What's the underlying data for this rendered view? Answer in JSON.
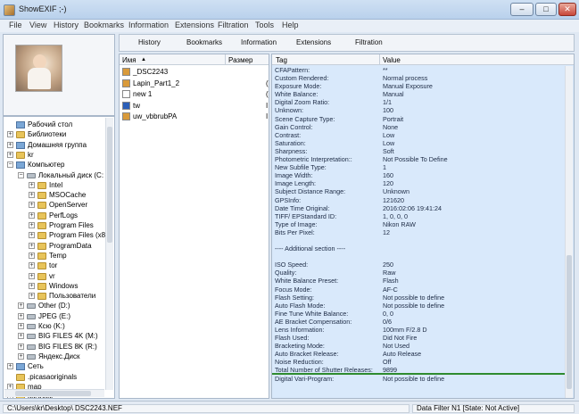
{
  "window": {
    "title": "ShowEXIF ;-)",
    "minimize": "–",
    "maximize": "□",
    "close": "✕"
  },
  "menu": [
    "File",
    "View",
    "History",
    "Bookmarks",
    "Information",
    "Extensions",
    "Filtration",
    "Tools",
    "Help"
  ],
  "tabs": [
    "History",
    "Bookmarks",
    "Information",
    "Extensions",
    "Filtration"
  ],
  "tree": [
    {
      "label": "Рабочий стол",
      "level": 0,
      "expander": "",
      "icon": "desktop"
    },
    {
      "label": "Библиотеки",
      "level": 0,
      "expander": "+",
      "icon": "folder"
    },
    {
      "label": "Домашняя группа",
      "level": 0,
      "expander": "+",
      "icon": "homegroup"
    },
    {
      "label": "kr",
      "level": 0,
      "expander": "+",
      "icon": "folder"
    },
    {
      "label": "Компьютер",
      "level": 0,
      "expander": "−",
      "icon": "computer"
    },
    {
      "label": "Локальный диск (C:",
      "level": 1,
      "expander": "−",
      "icon": "drive"
    },
    {
      "label": "Intel",
      "level": 2,
      "expander": "+",
      "icon": "folder"
    },
    {
      "label": "MSOCache",
      "level": 2,
      "expander": "+",
      "icon": "folder"
    },
    {
      "label": "OpenServer",
      "level": 2,
      "expander": "+",
      "icon": "folder"
    },
    {
      "label": "PerfLogs",
      "level": 2,
      "expander": "+",
      "icon": "folder"
    },
    {
      "label": "Program Files",
      "level": 2,
      "expander": "+",
      "icon": "folder"
    },
    {
      "label": "Program Files (x8",
      "level": 2,
      "expander": "+",
      "icon": "folder"
    },
    {
      "label": "ProgramData",
      "level": 2,
      "expander": "+",
      "icon": "folder"
    },
    {
      "label": "Temp",
      "level": 2,
      "expander": "+",
      "icon": "folder"
    },
    {
      "label": "tor",
      "level": 2,
      "expander": "+",
      "icon": "folder"
    },
    {
      "label": "vr",
      "level": 2,
      "expander": "+",
      "icon": "folder"
    },
    {
      "label": "Windows",
      "level": 2,
      "expander": "+",
      "icon": "folder"
    },
    {
      "label": "Пользователи",
      "level": 2,
      "expander": "+",
      "icon": "folder"
    },
    {
      "label": "Other (D:)",
      "level": 1,
      "expander": "+",
      "icon": "drive"
    },
    {
      "label": "JPEG (E:)",
      "level": 1,
      "expander": "+",
      "icon": "drive"
    },
    {
      "label": "Ксю (K:)",
      "level": 1,
      "expander": "+",
      "icon": "drive"
    },
    {
      "label": "BIG FILES 4K (M:)",
      "level": 1,
      "expander": "+",
      "icon": "drive"
    },
    {
      "label": "BIG FILES 8K (R:)",
      "level": 1,
      "expander": "+",
      "icon": "drive"
    },
    {
      "label": "Яндекс.Диск",
      "level": 1,
      "expander": "+",
      "icon": "yandex"
    },
    {
      "label": "Сеть",
      "level": 0,
      "expander": "+",
      "icon": "network"
    },
    {
      "label": ".picasaoriginals",
      "level": 0,
      "expander": "",
      "icon": "folder"
    },
    {
      "label": "map",
      "level": 0,
      "expander": "+",
      "icon": "folder"
    },
    {
      "label": "вызовы",
      "level": 0,
      "expander": "+",
      "icon": "folder"
    }
  ],
  "file_list": {
    "columns": [
      "Имя",
      "Размер"
    ],
    "sort_arrow": "▲",
    "items": [
      {
        "name": "_DSC2243",
        "size": "",
        "icon": "image"
      },
      {
        "name": "Lapin_Part1_2",
        "size": "(",
        "icon": "image"
      },
      {
        "name": "new 1",
        "size": "(",
        "icon": "blank"
      },
      {
        "name": "tw",
        "size": "I",
        "icon": "word"
      },
      {
        "name": "uw_vbbrubPA",
        "size": "I",
        "icon": "image"
      }
    ]
  },
  "tags": {
    "columns": [
      "Tag",
      "Value"
    ],
    "rows": [
      {
        "tag": "CFAPattern:",
        "value": "**"
      },
      {
        "tag": "Custom Rendered:",
        "value": "Normal process"
      },
      {
        "tag": "Exposure Mode:",
        "value": "Manual Exposure"
      },
      {
        "tag": "White Balance:",
        "value": "Manual"
      },
      {
        "tag": "Digital Zoom Ratio:",
        "value": "1/1"
      },
      {
        "tag": "Unknown:",
        "value": "100"
      },
      {
        "tag": "Scene Capture Type:",
        "value": "Portrait"
      },
      {
        "tag": "Gain Control:",
        "value": "None"
      },
      {
        "tag": "Contrast:",
        "value": "Low"
      },
      {
        "tag": "Saturation:",
        "value": "Low"
      },
      {
        "tag": "Sharpness:",
        "value": "Soft"
      },
      {
        "tag": "Photometric Interpretation::",
        "value": "Not Possible To Define"
      },
      {
        "tag": "New Subfile Type:",
        "value": "1"
      },
      {
        "tag": "Image Width:",
        "value": "160"
      },
      {
        "tag": "Image Length:",
        "value": "120"
      },
      {
        "tag": "Subject Distance Range:",
        "value": "Unknown"
      },
      {
        "tag": "GPSInfo:",
        "value": "121620"
      },
      {
        "tag": "Date Time Original:",
        "value": "2016:02:06 19:41:24"
      },
      {
        "tag": "TIFF/ EPStandard ID:",
        "value": "1, 0, 0, 0"
      },
      {
        "tag": "Type of Image:",
        "value": "Nikon RAW"
      },
      {
        "tag": "Bits Per Pixel:",
        "value": "12"
      },
      {
        "tag": "",
        "value": ""
      },
      {
        "tag": "---- Additional section ----",
        "value": ""
      },
      {
        "tag": "",
        "value": ""
      },
      {
        "tag": "ISO Speed:",
        "value": "250"
      },
      {
        "tag": "Quality:",
        "value": "Raw"
      },
      {
        "tag": "White Balance Preset:",
        "value": "Flash"
      },
      {
        "tag": "Focus Mode:",
        "value": "AF-C"
      },
      {
        "tag": "Flash Setting:",
        "value": "Not possible to define"
      },
      {
        "tag": "Auto Flash Mode:",
        "value": "Not possible to define"
      },
      {
        "tag": "Fine Tune White Balance:",
        "value": "0, 0"
      },
      {
        "tag": "AE Bracket Compensation:",
        "value": "0/6"
      },
      {
        "tag": "Lens Information:",
        "value": "100mm  F/2.8 D"
      },
      {
        "tag": "Flash Used:",
        "value": "Did Not Fire"
      },
      {
        "tag": "Bracketing Mode:",
        "value": "Not Used"
      },
      {
        "tag": "Auto Bracket Release:",
        "value": "Auto Release"
      },
      {
        "tag": "Noise Reduction:",
        "value": "Off"
      },
      {
        "tag": "Total Number of Shutter Releases:",
        "value": "9899",
        "highlight": true
      },
      {
        "tag": "Digital Vari-Program:",
        "value": "Not possible to define"
      }
    ]
  },
  "status": {
    "path": "C:\\Users\\kr\\Desktop\\  DSC2243.NEF",
    "right": "Data Filter N1 [State: Not Active]"
  }
}
